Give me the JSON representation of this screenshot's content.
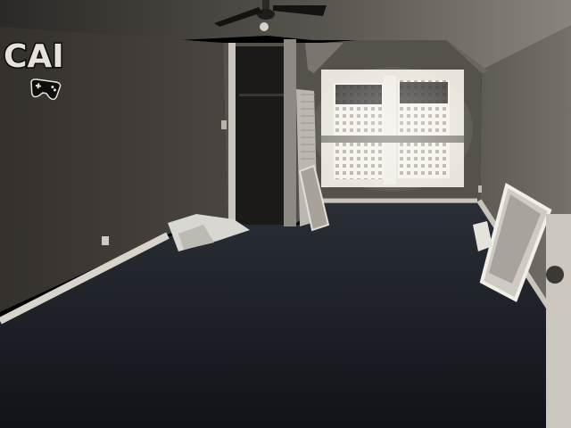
{
  "scene": {
    "wall_decal_text": "CAI",
    "icons": {
      "decal_graphic": "game-controller-icon",
      "ceiling_fixture": "ceiling-fan-icon"
    },
    "colors": {
      "carpet": "#1c1f26",
      "left_wall": "#3f3b36",
      "back_wall": "#5a5650",
      "right_wall": "#6d6963",
      "ceiling": "#3a3733",
      "window_light": "#f4f1ea",
      "trim": "#d8d4cc"
    }
  }
}
